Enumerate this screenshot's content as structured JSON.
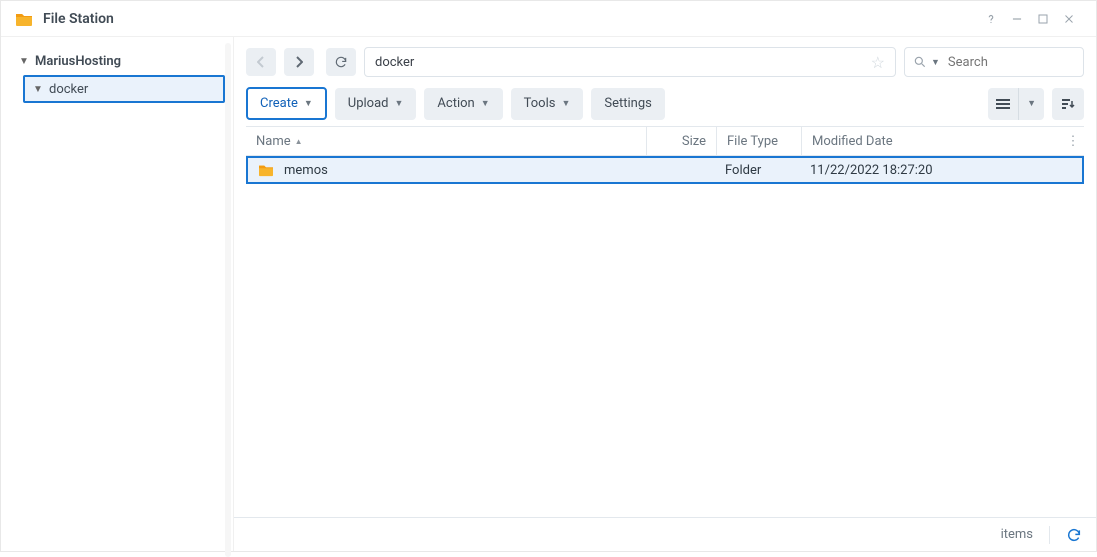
{
  "window": {
    "title": "File Station"
  },
  "sidebar": {
    "root": "MariusHosting",
    "child": "docker"
  },
  "path": {
    "value": "docker"
  },
  "search": {
    "placeholder": "Search"
  },
  "toolbar": {
    "create": "Create",
    "upload": "Upload",
    "action": "Action",
    "tools": "Tools",
    "settings": "Settings"
  },
  "columns": {
    "name": "Name",
    "size": "Size",
    "type": "File Type",
    "date": "Modified Date"
  },
  "rows": [
    {
      "name": "memos",
      "size": "",
      "type": "Folder",
      "date": "11/22/2022 18:27:20"
    }
  ],
  "status": {
    "items": "items"
  }
}
